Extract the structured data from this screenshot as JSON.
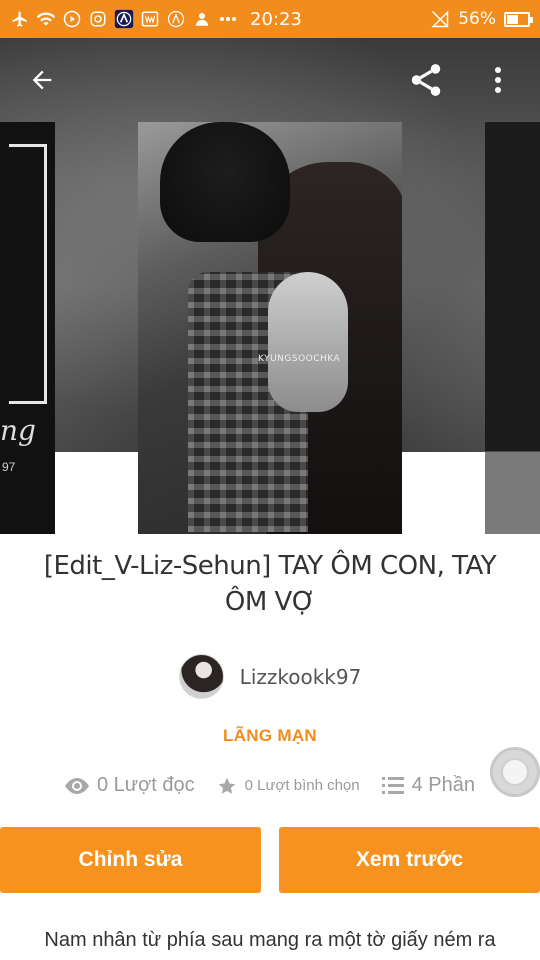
{
  "status_bar": {
    "time": "20:23",
    "battery": "56%",
    "battery_level": 0.56
  },
  "app_bar": {
    "back_icon": "arrow-left-icon",
    "share_icon": "share-icon",
    "menu_icon": "more-vertical-icon"
  },
  "covers": {
    "center_watermark": "KYUNGSOOCHKA",
    "left_partial_text": "ng",
    "left_partial_num": "97"
  },
  "story": {
    "title": "[Edit_V-Liz-Sehun] TAY ÔM CON, TAY ÔM VỢ",
    "author": "Lizzkookk97",
    "genre": "LÃNG MẠN",
    "reads": "0 Lượt đọc",
    "votes": "0 Lượt bình chọn",
    "parts": "4 Phần",
    "description": "Nam nhân từ phía sau mang ra một tờ giấy ném ra"
  },
  "buttons": {
    "edit": "Chỉnh sửa",
    "preview": "Xem trước"
  },
  "colors": {
    "accent": "#f28c1c",
    "button": "#f7921e"
  }
}
